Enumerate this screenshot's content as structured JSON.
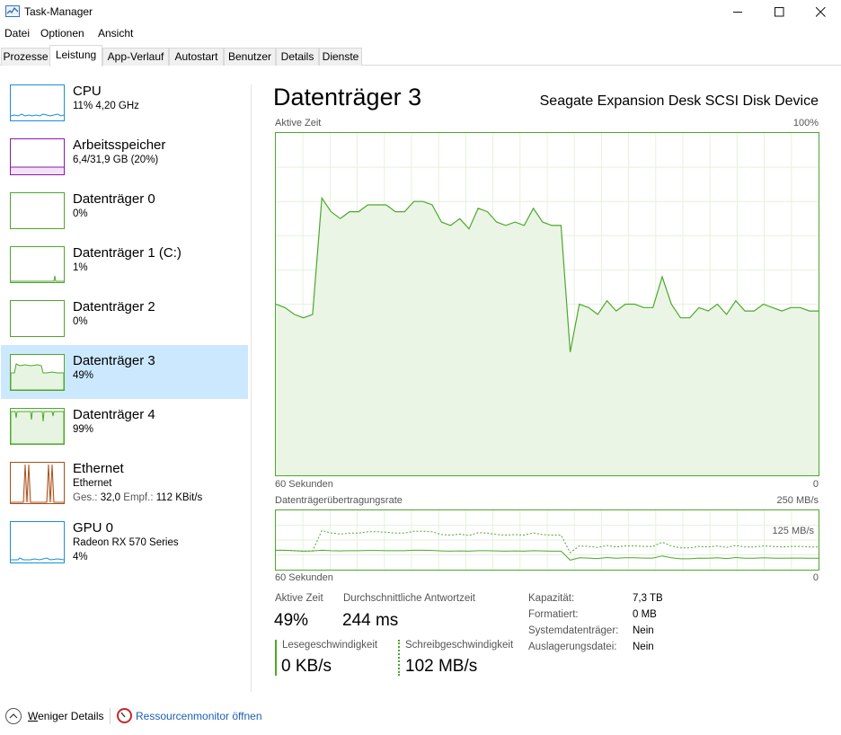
{
  "window": {
    "title": "Task-Manager"
  },
  "menu": [
    "Datei",
    "Optionen",
    "Ansicht"
  ],
  "tabs": [
    "Prozesse",
    "Leistung",
    "App-Verlauf",
    "Autostart",
    "Benutzer",
    "Details",
    "Dienste"
  ],
  "sidebar": [
    {
      "name": "CPU",
      "sub": "11% 4,20 GHz",
      "color": "#1a8fd6"
    },
    {
      "name": "Arbeitsspeicher",
      "sub": "6,4/31,9 GB (20%)",
      "color": "#8b1aa8"
    },
    {
      "name": "Datenträger 0",
      "sub": "0%",
      "color": "#4ea72c"
    },
    {
      "name": "Datenträger 1 (C:)",
      "sub": "1%",
      "color": "#4ea72c"
    },
    {
      "name": "Datenträger 2",
      "sub": "0%",
      "color": "#4ea72c"
    },
    {
      "name": "Datenträger 3",
      "sub": "49%",
      "color": "#4ea72c"
    },
    {
      "name": "Datenträger 4",
      "sub": "99%",
      "color": "#4ea72c"
    },
    {
      "name": "Ethernet",
      "sub": "Ethernet",
      "sub2_label": "Ges.:",
      "sub2_value": "32,0",
      "sub2_label2": "Empf.:",
      "sub2_value2": "112 KBit/s",
      "color": "#a7501a"
    },
    {
      "name": "GPU 0",
      "sub": "Radeon RX 570 Series",
      "sub3": "4%",
      "color": "#1a8fd6"
    }
  ],
  "main": {
    "title": "Datenträger 3",
    "device": "Seagate Expansion Desk SCSI Disk Device",
    "chart1": {
      "label": "Aktive Zeit",
      "max_label": "100%",
      "x_left": "60 Sekunden",
      "x_right": "0"
    },
    "chart2": {
      "label": "Datenträgerübertragungsrate",
      "max_label": "250 MB/s",
      "mid_label": "125 MB/s",
      "x_left": "60 Sekunden",
      "x_right": "0"
    }
  },
  "stats": {
    "active_time": {
      "label": "Aktive Zeit",
      "value": "49%"
    },
    "response": {
      "label": "Durchschnittliche Antwortzeit",
      "value": "244 ms"
    },
    "read": {
      "label": "Lesegeschwindigkeit",
      "value": "0 KB/s"
    },
    "write": {
      "label": "Schreibgeschwindigkeit",
      "value": "102 MB/s"
    }
  },
  "properties": [
    {
      "label": "Kapazität:",
      "value": "7,3 TB"
    },
    {
      "label": "Formatiert:",
      "value": "0 MB"
    },
    {
      "label": "Systemdatenträger:",
      "value": "Nein"
    },
    {
      "label": "Auslagerungsdatei:",
      "value": "Nein"
    }
  ],
  "footer": {
    "less_details_u": "W",
    "less_details_rest": "eniger Details",
    "resmon": "Ressourcenmonitor öffnen"
  },
  "chart_data": [
    {
      "type": "area",
      "title": "Aktive Zeit",
      "ylim": [
        0,
        100
      ],
      "xlim": [
        60,
        0
      ],
      "grid": true,
      "color": "#4ea72c",
      "values": [
        50,
        49,
        47,
        46,
        47,
        81,
        77,
        75,
        77,
        77,
        79,
        79,
        79,
        77,
        77,
        80,
        80,
        79,
        74,
        73,
        75,
        72,
        78,
        77,
        74,
        73,
        74,
        73,
        78,
        74,
        73,
        73,
        36,
        50,
        49,
        47,
        51,
        48,
        50,
        50,
        49,
        49,
        58,
        50,
        46,
        46,
        49,
        48,
        50,
        47,
        51,
        48,
        48,
        50,
        49,
        48,
        49,
        49,
        48,
        48
      ],
      "series": [
        {
          "values": [
            50,
            49,
            47,
            46,
            47,
            81,
            77,
            75,
            77,
            77,
            79,
            79,
            79,
            77,
            77,
            80,
            80,
            79,
            74,
            73,
            75,
            72,
            78,
            77,
            74,
            73,
            74,
            73,
            78,
            74,
            73,
            73,
            36,
            50,
            49,
            47,
            51,
            48,
            50,
            50,
            49,
            49,
            58,
            50,
            46,
            46,
            49,
            48,
            50,
            47,
            51,
            48,
            48,
            50,
            49,
            48,
            49,
            49,
            48,
            48
          ]
        }
      ]
    },
    {
      "type": "line",
      "title": "Datenträgerübertragungsrate",
      "ylim": [
        0,
        250
      ],
      "xlim": [
        60,
        0
      ],
      "grid": true,
      "color": "#4ea72c",
      "series": [
        {
          "values": [
            82,
            82,
            80,
            78,
            79,
            165,
            155,
            150,
            154,
            154,
            160,
            160,
            158,
            154,
            154,
            162,
            162,
            160,
            148,
            146,
            150,
            144,
            156,
            154,
            148,
            146,
            148,
            146,
            155,
            148,
            146,
            146,
            72,
            100,
            98,
            94,
            102,
            96,
            100,
            100,
            98,
            98,
            116,
            100,
            92,
            92,
            98,
            96,
            100,
            94,
            102,
            96,
            96,
            100,
            98,
            96,
            98,
            98,
            96,
            96
          ]
        },
        {
          "values": [
            82,
            82,
            80,
            78,
            79,
            82,
            80,
            79,
            80,
            80,
            81,
            81,
            80,
            80,
            80,
            82,
            82,
            81,
            79,
            78,
            79,
            78,
            80,
            80,
            79,
            78,
            79,
            78,
            80,
            79,
            78,
            78,
            40,
            50,
            49,
            47,
            51,
            48,
            50,
            50,
            49,
            49,
            58,
            50,
            46,
            46,
            49,
            48,
            50,
            47,
            51,
            48,
            48,
            50,
            49,
            48,
            49,
            49,
            48,
            48
          ]
        }
      ]
    }
  ]
}
